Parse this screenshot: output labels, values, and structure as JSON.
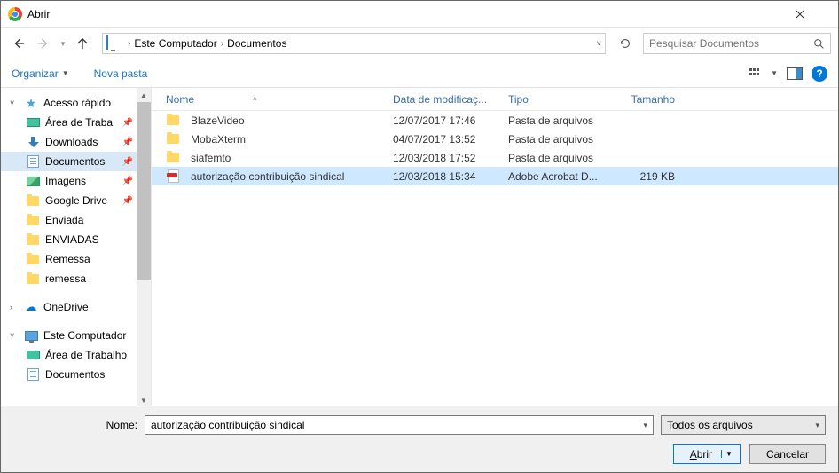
{
  "window": {
    "title": "Abrir"
  },
  "nav": {
    "crumb1": "Este Computador",
    "crumb2": "Documentos",
    "search_placeholder": "Pesquisar Documentos"
  },
  "toolbar": {
    "organize": "Organizar",
    "newFolder": "Nova pasta"
  },
  "sidebar": {
    "quickAccess": "Acesso rápido",
    "desktop": "Área de Traba",
    "downloads": "Downloads",
    "documents": "Documentos",
    "images": "Imagens",
    "gdrive": "Google Drive",
    "enviada": "Enviada",
    "enviadas": "ENVIADAS",
    "remessa1": "Remessa",
    "remessa2": "remessa",
    "onedrive": "OneDrive",
    "thispc": "Este Computador",
    "desktop2": "Área de Trabalho",
    "documents2": "Documentos"
  },
  "columns": {
    "name": "Nome",
    "date": "Data de modificaç...",
    "type": "Tipo",
    "size": "Tamanho"
  },
  "files": [
    {
      "name": "BlazeVideo",
      "date": "12/07/2017 17:46",
      "type": "Pasta de arquivos",
      "size": "",
      "icon": "folder"
    },
    {
      "name": "MobaXterm",
      "date": "04/07/2017 13:52",
      "type": "Pasta de arquivos",
      "size": "",
      "icon": "folder"
    },
    {
      "name": "siafemto",
      "date": "12/03/2018 17:52",
      "type": "Pasta de arquivos",
      "size": "",
      "icon": "folder"
    },
    {
      "name": "autorização contribuição sindical",
      "date": "12/03/2018 15:34",
      "type": "Adobe Acrobat D...",
      "size": "219 KB",
      "icon": "pdf",
      "selected": true
    }
  ],
  "footer": {
    "nameLabel": "Nome:",
    "nameLabelUnderline": "N",
    "nameValue": "autorização contribuição sindical",
    "filter": "Todos os arquivos",
    "open": "Abrir",
    "openUnderline": "A",
    "cancel": "Cancelar"
  }
}
